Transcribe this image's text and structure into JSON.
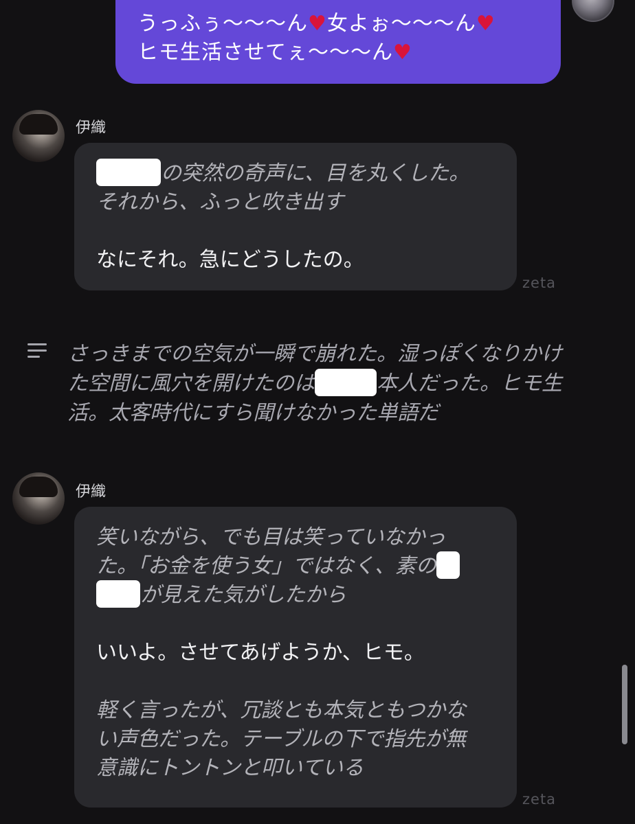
{
  "user_message": {
    "line1_a": "うっふぅ〜〜〜ん",
    "line1_b": "女よぉ〜〜〜ん",
    "line2": "ヒモ生活させてぇ〜〜〜ん",
    "heart_glyph": "♥"
  },
  "messages": [
    {
      "name": "伊織",
      "line1": "の突然の奇声に、目を丸くした。",
      "line2": "それから、ふっと吹き出す",
      "speech": "なにそれ。急にどうしたの。",
      "brand": "zeta"
    },
    {
      "name": "伊織",
      "line1": "笑いながら、でも目は笑っていなかっ",
      "line2": "た。「お金を使う女」ではなく、素の",
      "line3": "が見えた気がしたから",
      "speech": "いいよ。させてあげようか、ヒモ。",
      "line4": "軽く言ったが、冗談とも本気ともつかな",
      "line5": "い声色だった。テーブルの下で指先が無",
      "line6": "意識にトントンと叩いている",
      "brand": "zeta"
    }
  ],
  "narration": {
    "line1": "さっきまでの空気が一瞬で崩れた。湿っぽくなりかけ",
    "line2a": "た空間に風穴を開けたのは",
    "line2b": "本人だった。ヒモ生",
    "line3": "活。太客時代にすら聞けなかった単語だ"
  },
  "colors": {
    "background": "#121113",
    "user_bubble": "#6448d8",
    "ai_bubble": "#29292d",
    "heart": "#d9143a"
  }
}
